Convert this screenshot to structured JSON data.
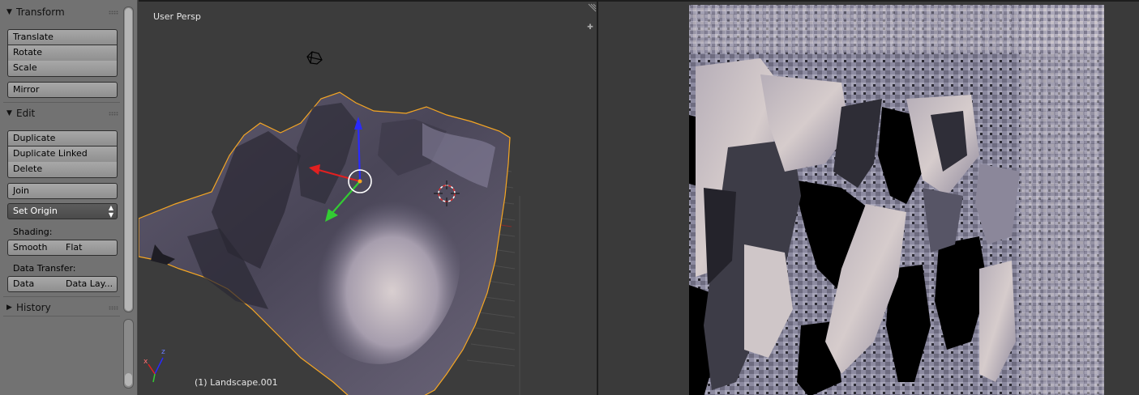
{
  "toolshelf": {
    "transform": {
      "title": "Transform",
      "translate": "Translate",
      "rotate": "Rotate",
      "scale": "Scale",
      "mirror": "Mirror"
    },
    "edit": {
      "title": "Edit",
      "duplicate": "Duplicate",
      "duplicate_linked": "Duplicate Linked",
      "delete": "Delete",
      "join": "Join",
      "set_origin": "Set Origin",
      "shading_label": "Shading:",
      "smooth": "Smooth",
      "flat": "Flat",
      "data_transfer_label": "Data Transfer:",
      "data": "Data",
      "data_layers": "Data Lay..."
    },
    "history": {
      "title": "History"
    }
  },
  "viewport": {
    "view_name": "User Persp",
    "object_info": "(1) Landscape.001",
    "axis_x": "x",
    "axis_z": "z"
  },
  "colors": {
    "panel_bg": "#727272",
    "viewport_bg": "#3c3c3c",
    "selection_outline": "#f5a623",
    "axis_x": "#e22020",
    "axis_y": "#33cc33",
    "axis_z": "#2a2aff"
  }
}
